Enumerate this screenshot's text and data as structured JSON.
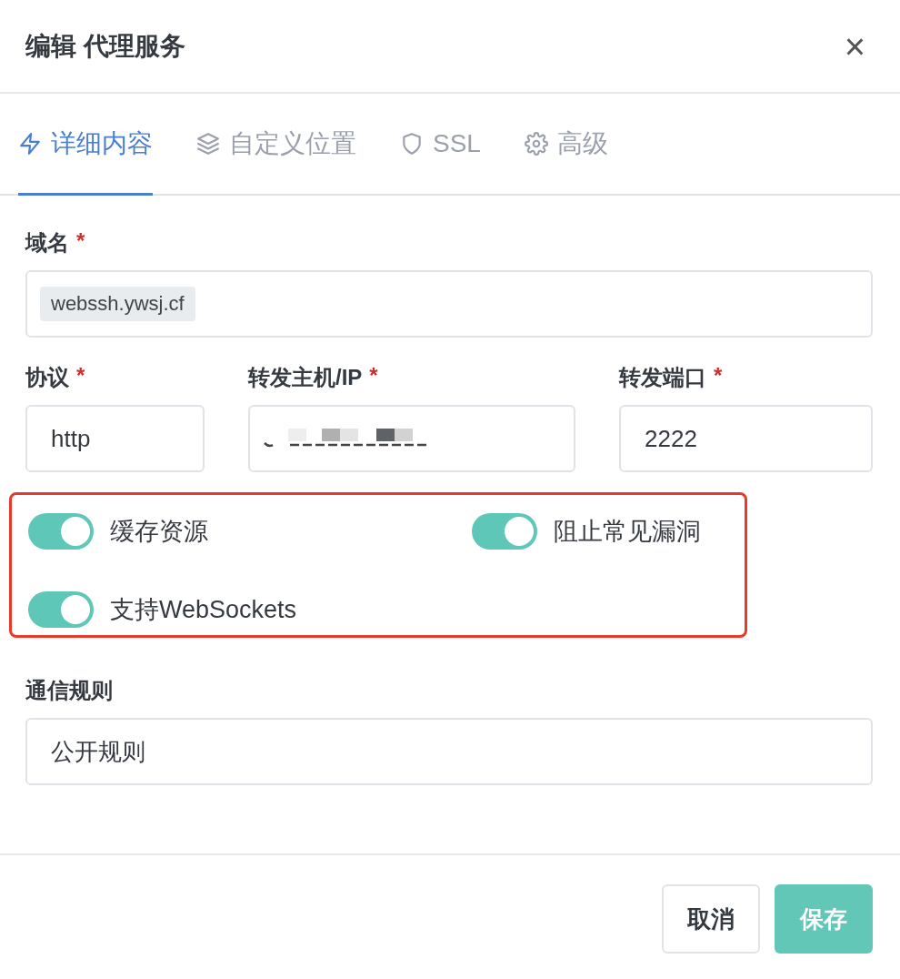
{
  "dialog": {
    "title": "编辑 代理服务",
    "close": "×"
  },
  "tabs": [
    {
      "label": "详细内容",
      "selected": true
    },
    {
      "label": "自定义位置",
      "selected": false
    },
    {
      "label": "SSL",
      "selected": false
    },
    {
      "label": "高级",
      "selected": false
    }
  ],
  "domain": {
    "label": "域名",
    "required": "*",
    "chips": [
      "webssh.ywsj.cf"
    ]
  },
  "fields": [
    {
      "label": "协议",
      "required": "*",
      "value": "http",
      "kind": "text"
    },
    {
      "label": "转发主机/IP",
      "required": "*",
      "kind": "redacted"
    },
    {
      "label": "转发端口",
      "required": "*",
      "value": "2222",
      "kind": "text"
    }
  ],
  "options": {
    "highlighted": true,
    "toggles": [
      {
        "label": "缓存资源",
        "on": true
      },
      {
        "label": "阻止常见漏洞",
        "on": true
      },
      {
        "label": "支持WebSockets",
        "on": true
      }
    ]
  },
  "rules": {
    "label": "通信规则",
    "value": "公开规则"
  },
  "buttons": [
    {
      "label": "取消",
      "kind": "secondary"
    },
    {
      "label": "保存",
      "kind": "primary"
    }
  ]
}
